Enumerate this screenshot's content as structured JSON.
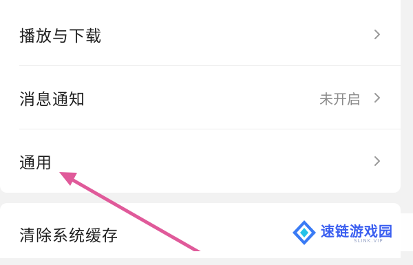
{
  "settings": {
    "items": [
      {
        "label": "播放与下载",
        "value": ""
      },
      {
        "label": "消息通知",
        "value": "未开启"
      },
      {
        "label": "通用",
        "value": ""
      },
      {
        "label": "清除系统缓存",
        "value": ""
      }
    ]
  },
  "annotation": {
    "arrow_color": "#e05a9a",
    "icon": "pink-arrow"
  },
  "watermark": {
    "title": "速链游戏园",
    "subtitle": "SLINK.VIP",
    "logo_color": "#3a7bf5",
    "icon": "diamond-logo-icon"
  }
}
